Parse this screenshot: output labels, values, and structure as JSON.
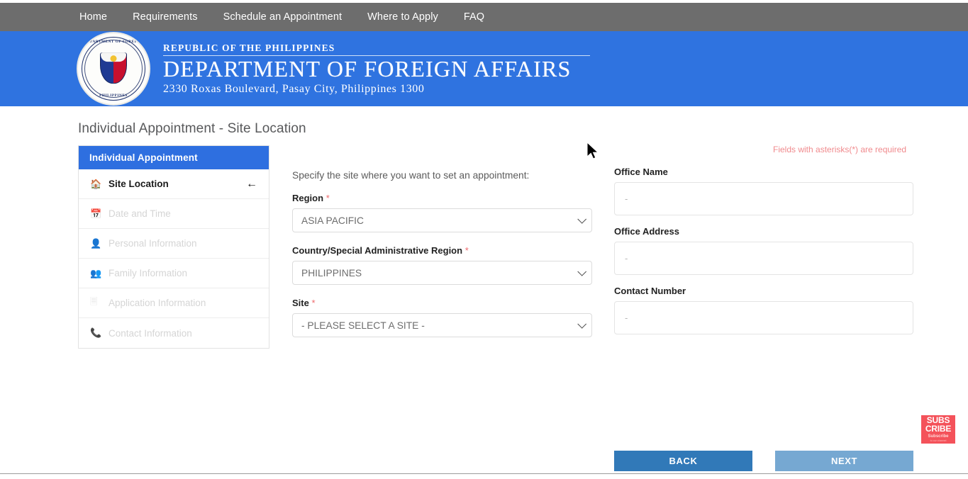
{
  "nav": {
    "items": [
      {
        "label": "Home"
      },
      {
        "label": "Requirements"
      },
      {
        "label": "Schedule an Appointment"
      },
      {
        "label": "Where to Apply"
      },
      {
        "label": "FAQ"
      }
    ]
  },
  "banner": {
    "seal_top_text": "DEPARTMENT OF FOREIGN",
    "seal_bottom_text": "PHILIPPINES",
    "line1": "REPUBLIC OF THE PHILIPPINES",
    "line2": "DEPARTMENT OF FOREIGN AFFAIRS",
    "line3": "2330 Roxas Boulevard, Pasay City, Philippines 1300",
    "background_color": "#2f73e0"
  },
  "page": {
    "title": "Individual Appointment - Site Location",
    "required_note": "Fields with asterisks(*) are required",
    "required_note_color": "#f08a8d"
  },
  "sidebar": {
    "header": "Individual Appointment",
    "header_color": "#2e6fe0",
    "items": [
      {
        "label": "Site Location",
        "icon": "home-icon",
        "state": "active",
        "trailing_icon": "arrow-left-icon"
      },
      {
        "label": "Date and Time",
        "icon": "calendar-icon",
        "state": "disabled"
      },
      {
        "label": "Personal Information",
        "icon": "user-icon",
        "state": "disabled"
      },
      {
        "label": "Family Information",
        "icon": "users-icon",
        "state": "disabled"
      },
      {
        "label": "Application Information",
        "icon": "id-card-icon",
        "state": "disabled"
      },
      {
        "label": "Contact Information",
        "icon": "phone-icon",
        "state": "disabled"
      }
    ]
  },
  "form": {
    "intro": "Specify the site where you want to set an appointment:",
    "fields": [
      {
        "label": "Region",
        "required": "*",
        "value": "ASIA PACIFIC"
      },
      {
        "label": "Country/Special Administrative Region",
        "required": "*",
        "value": "PHILIPPINES"
      },
      {
        "label": "Site",
        "required": "*",
        "value": "- PLEASE SELECT A SITE -"
      }
    ]
  },
  "site_details": {
    "fields": [
      {
        "label": "Office Name",
        "value": "-"
      },
      {
        "label": "Office Address",
        "value": "-"
      },
      {
        "label": "Contact Number",
        "value": "-"
      }
    ]
  },
  "actions": {
    "back_label": "BACK",
    "back_color": "#3179b8",
    "next_label": "NEXT",
    "next_color": "#76a8d2"
  },
  "subscribe_badge": {
    "line1": "SUBS",
    "line2": "CRIBE",
    "line3": "Subscribe",
    "line4": "to our channel",
    "color": "#f4525a"
  }
}
